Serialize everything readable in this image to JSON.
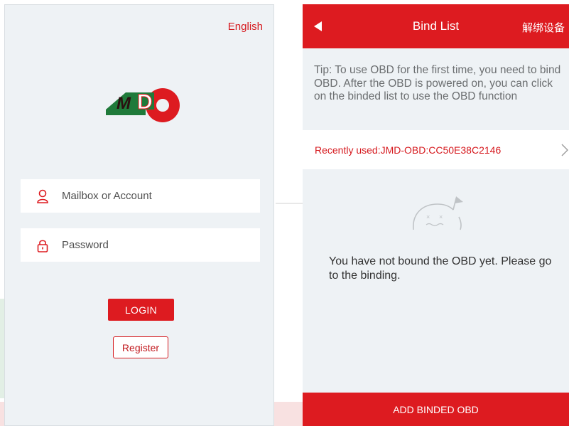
{
  "login": {
    "language": "English",
    "account_placeholder": "Mailbox or Account",
    "password_placeholder": "Password",
    "login_label": "LOGIN",
    "register_label": "Register",
    "logo_text": "JMD"
  },
  "bind": {
    "title": "Bind List",
    "action": "解绑设备",
    "tip": "Tip: To use OBD for the first time, you need to bind OBD. After the OBD is powered on, you can click on the binded list to use the OBD function",
    "recent": "Recently used:JMD-OBD:CC50E38C2146",
    "empty_message": "You have not bound the OBD yet. Please go to the binding.",
    "add_label": "ADD BINDED OBD"
  },
  "icons": {
    "back": "back-triangle-icon",
    "chevron": "chevron-right-icon",
    "user": "user-icon",
    "lock": "lock-icon",
    "empty": "empty-face-icon"
  },
  "colors": {
    "brand_red": "#dd1b20",
    "brand_green": "#1f7a3a",
    "background": "#eef2f5"
  }
}
